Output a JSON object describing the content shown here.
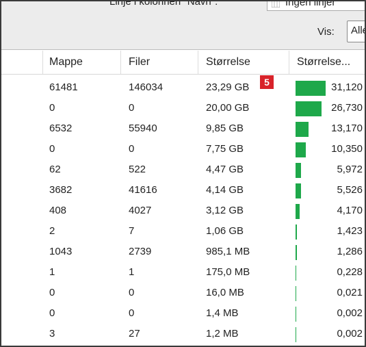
{
  "toolbar": {
    "line_label": "Linje i kolonnen \"Navn\":",
    "line_value": "Ingen linjer",
    "vis_label": "Vis:",
    "vis_value": "Alle"
  },
  "table": {
    "headers": [
      "Mappe",
      "Filer",
      "Størrelse",
      "Størrelse..."
    ],
    "rows": [
      {
        "mappe": "61481",
        "filer": "146034",
        "storrelse": "23,29 GB",
        "pct": "31,120",
        "fraction": 0.3112
      },
      {
        "mappe": "0",
        "filer": "0",
        "storrelse": "20,00 GB",
        "pct": "26,730",
        "fraction": 0.2673
      },
      {
        "mappe": "6532",
        "filer": "55940",
        "storrelse": "9,85 GB",
        "pct": "13,170",
        "fraction": 0.1317
      },
      {
        "mappe": "0",
        "filer": "0",
        "storrelse": "7,75 GB",
        "pct": "10,350",
        "fraction": 0.1035
      },
      {
        "mappe": "62",
        "filer": "522",
        "storrelse": "4,47 GB",
        "pct": "5,972",
        "fraction": 0.05972
      },
      {
        "mappe": "3682",
        "filer": "41616",
        "storrelse": "4,14 GB",
        "pct": "5,526",
        "fraction": 0.05526
      },
      {
        "mappe": "408",
        "filer": "4027",
        "storrelse": "3,12 GB",
        "pct": "4,170",
        "fraction": 0.0417
      },
      {
        "mappe": "2",
        "filer": "7",
        "storrelse": "1,06 GB",
        "pct": "1,423",
        "fraction": 0.01423
      },
      {
        "mappe": "1043",
        "filer": "2739",
        "storrelse": "985,1 MB",
        "pct": "1,286",
        "fraction": 0.01286
      },
      {
        "mappe": "1",
        "filer": "1",
        "storrelse": "175,0 MB",
        "pct": "0,228",
        "fraction": 0.00228
      },
      {
        "mappe": "0",
        "filer": "0",
        "storrelse": "16,0 MB",
        "pct": "0,021",
        "fraction": 0.00021
      },
      {
        "mappe": "0",
        "filer": "0",
        "storrelse": "1,4 MB",
        "pct": "0,002",
        "fraction": 2e-05
      },
      {
        "mappe": "3",
        "filer": "27",
        "storrelse": "1,2 MB",
        "pct": "0,002",
        "fraction": 2e-05
      }
    ]
  },
  "callout_badge": "5",
  "colors": {
    "bar": "#1ea84a",
    "badge": "#d8232a"
  }
}
